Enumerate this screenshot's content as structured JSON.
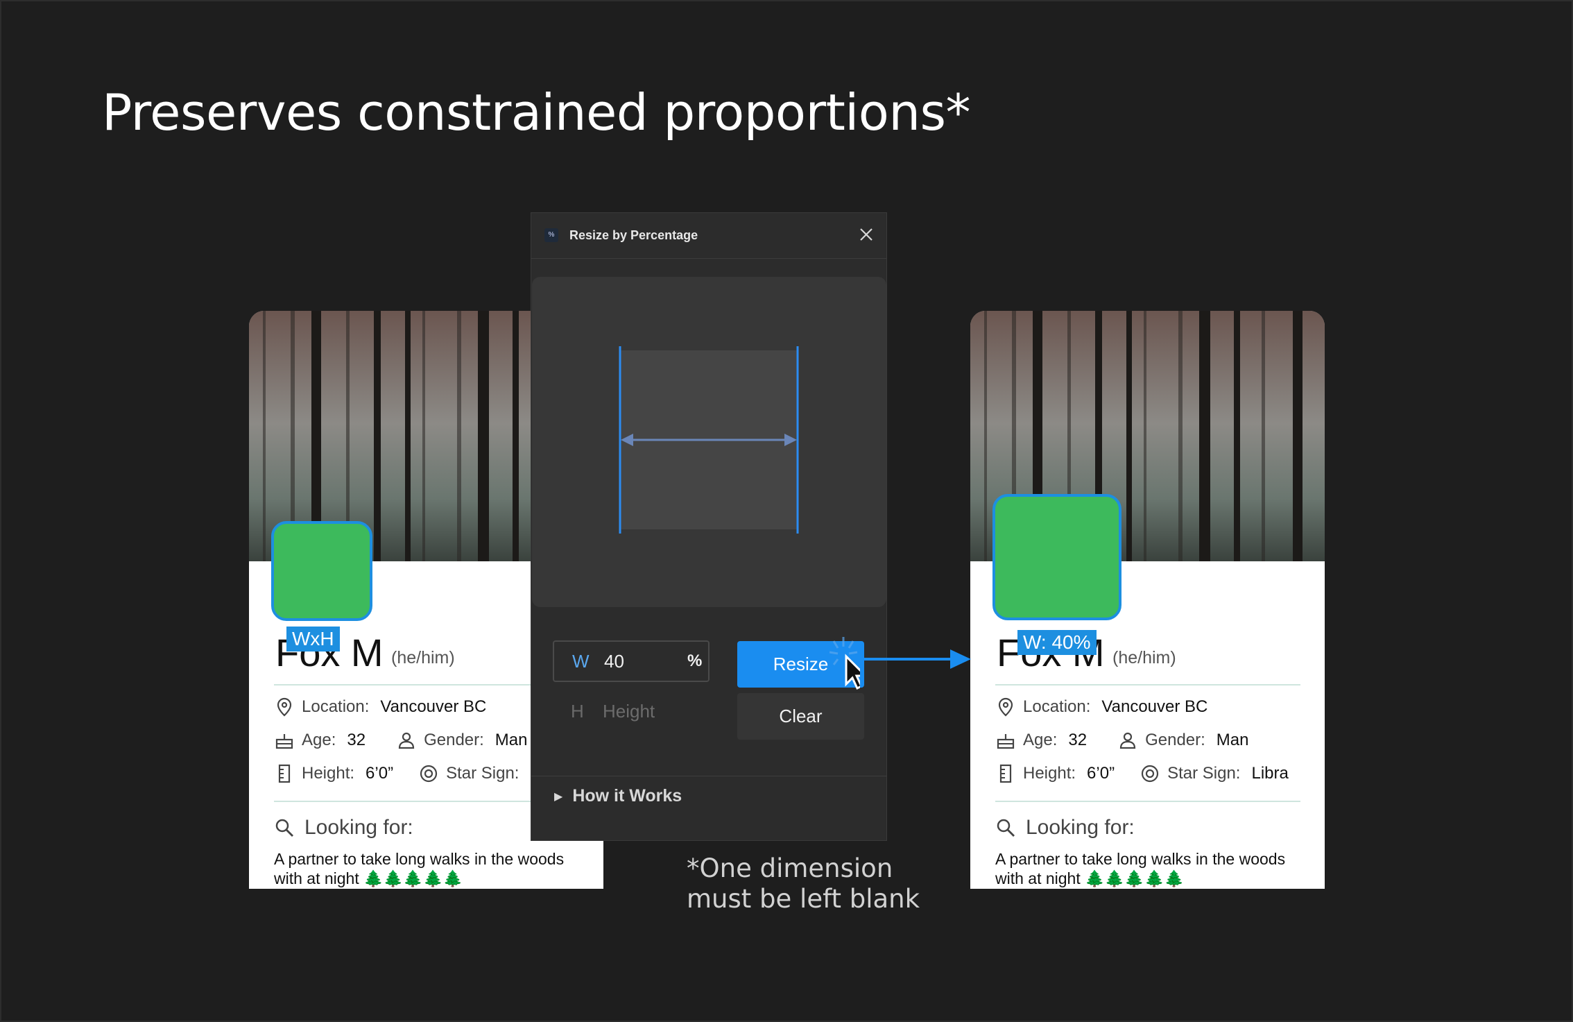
{
  "headline": "Preserves constrained proportions*",
  "footnote": [
    "*One dimension",
    "must be left blank"
  ],
  "plugin": {
    "app_icon": "%",
    "title": "Resize by Percentage",
    "close_icon": "close-icon",
    "width_field": {
      "prefix": "W",
      "value": "40",
      "unit": "%"
    },
    "height_field": {
      "prefix": "H",
      "placeholder": "Height"
    },
    "resize_label": "Resize",
    "clear_label": "Clear",
    "how_it_works": "How it Works"
  },
  "cards": [
    {
      "name": "Fox M",
      "pronoun": "(he/him)",
      "dim_tag": "WxH",
      "location_label": "Location:",
      "location_value": "Vancouver BC",
      "age_label": "Age:",
      "age_value": "32",
      "gender_label": "Gender:",
      "gender_value": "Man",
      "height_label": "Height:",
      "height_value": "6’0”",
      "star_label": "Star Sign:",
      "star_value": "",
      "looking_label": "Looking for:",
      "description": "A partner to take long walks in the woods with at night 🌲🌲🌲🌲🌲"
    },
    {
      "name": "Fox M",
      "pronoun": "(he/him)",
      "dim_tag": "W: 40%",
      "location_label": "Location:",
      "location_value": "Vancouver BC",
      "age_label": "Age:",
      "age_value": "32",
      "gender_label": "Gender:",
      "gender_value": "Man",
      "height_label": "Height:",
      "height_value": "6’0”",
      "star_label": "Star Sign:",
      "star_value": "Libra",
      "looking_label": "Looking for:",
      "description": "A partner to take long walks in the woods with at night 🌲🌲🌲🌲🌲"
    }
  ],
  "colors": {
    "background": "#1e1e1e",
    "accent": "#1a8df0",
    "avatar": "#3dba5c",
    "panel": "#2c2c2c"
  }
}
